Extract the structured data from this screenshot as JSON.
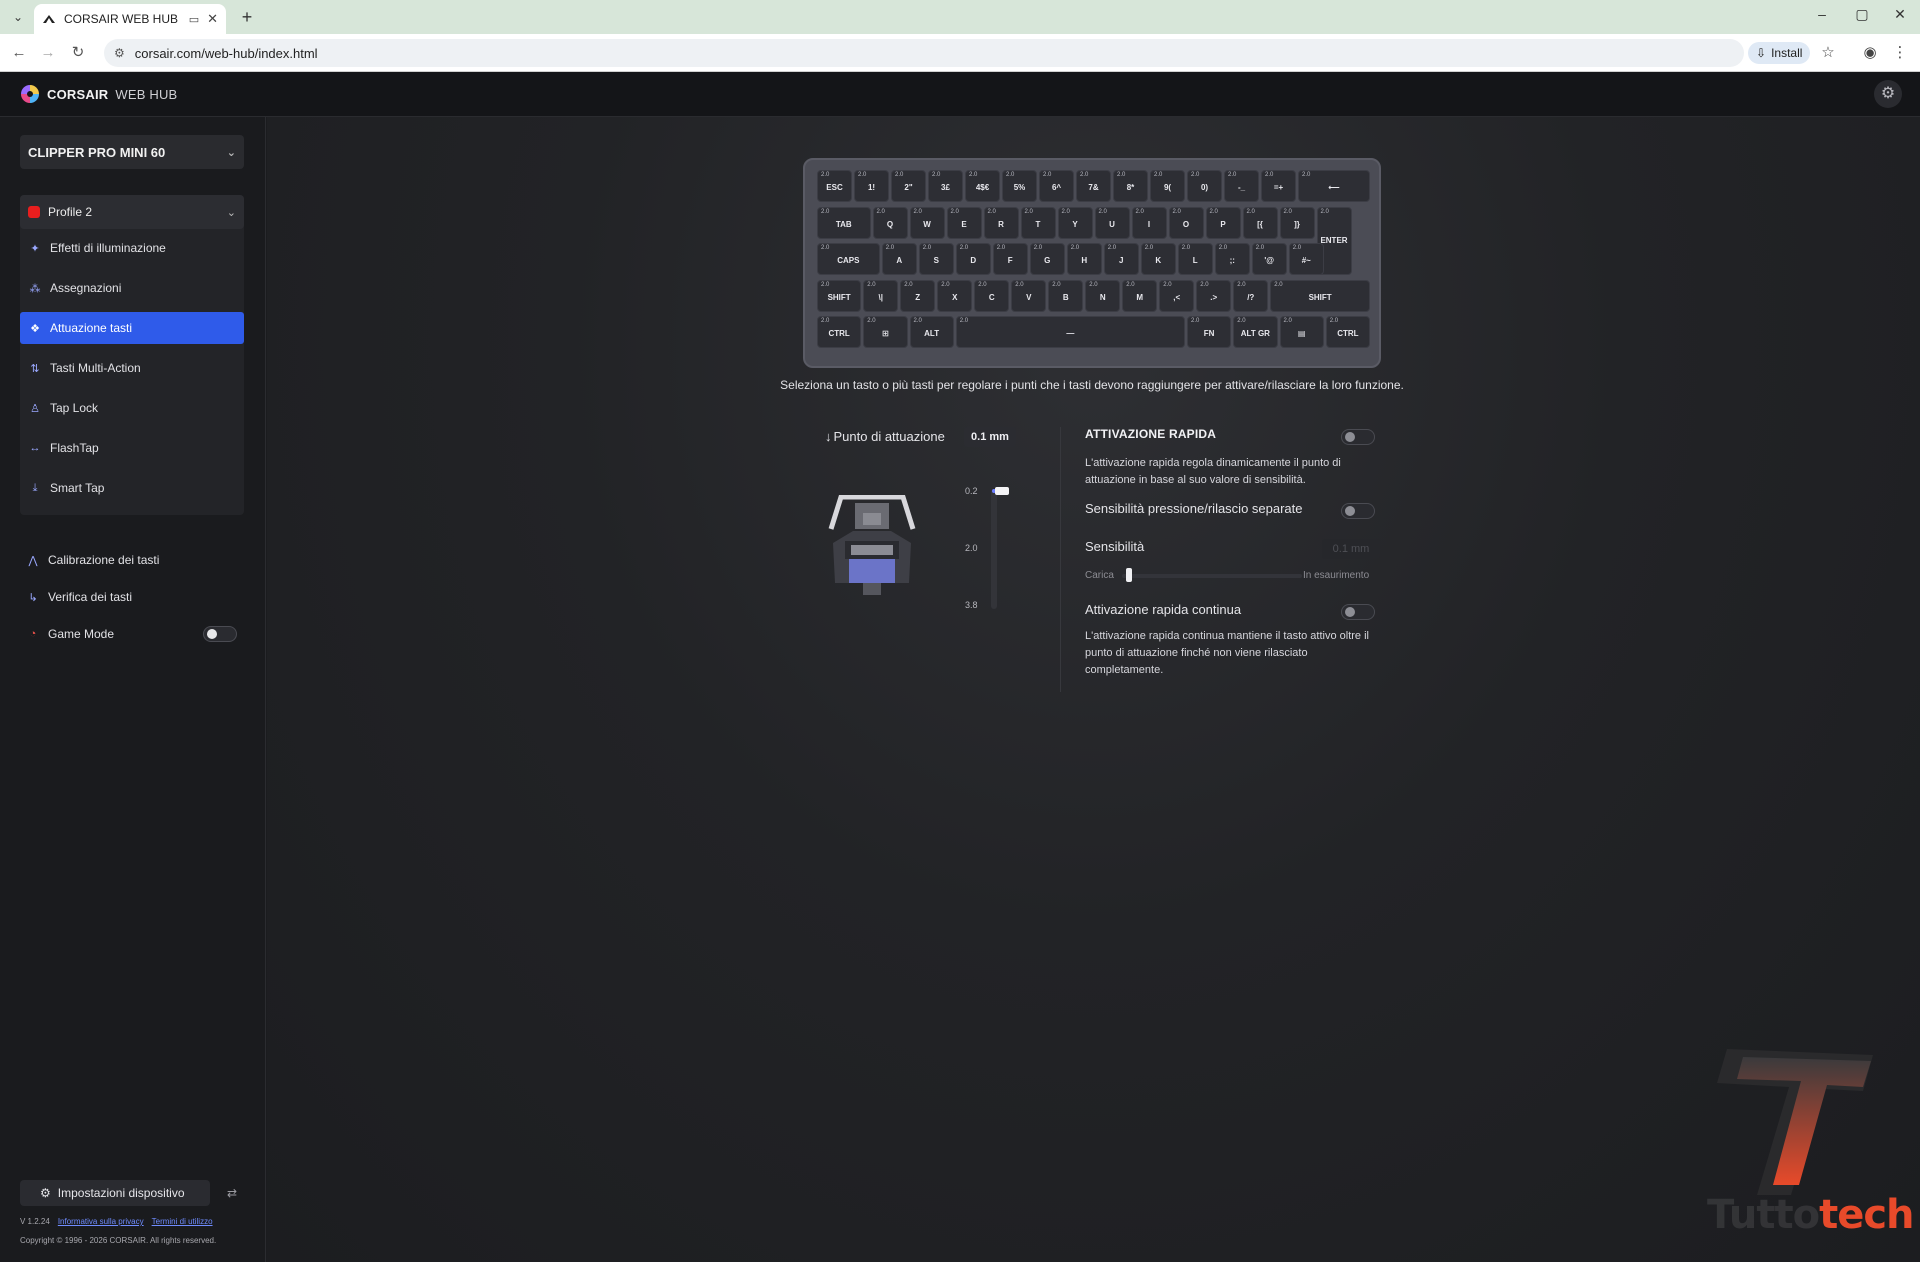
{
  "browser": {
    "tab_title": "CORSAIR WEB HUB",
    "url": "corsair.com/web-hub/index.html",
    "install_label": "Install"
  },
  "app": {
    "brand": "CORSAIR",
    "brand_sub": "WEB HUB"
  },
  "sidebar": {
    "device": "CLIPPER PRO MINI 60",
    "profile": "Profile 2",
    "profile_color": "#e81e1e",
    "menu": [
      {
        "label": "Effetti di illuminazione",
        "icon": "sparkle-icon"
      },
      {
        "label": "Assegnazioni",
        "icon": "assign-icon"
      },
      {
        "label": "Attuazione tasti",
        "icon": "actuation-icon"
      },
      {
        "label": "Tasti Multi-Action",
        "icon": "multi-action-icon"
      },
      {
        "label": "Tap Lock",
        "icon": "tap-lock-icon"
      },
      {
        "label": "FlashTap",
        "icon": "flashtap-icon"
      },
      {
        "label": "Smart Tap",
        "icon": "smart-tap-icon"
      }
    ],
    "active_item": "Attuazione tasti",
    "links": [
      {
        "label": "Calibrazione dei tasti"
      },
      {
        "label": "Verifica dei tasti"
      },
      {
        "label": "Game Mode"
      }
    ],
    "device_settings": "Impostazioni dispositivo",
    "version": "V 1.2.24",
    "privacy": "Informativa sulla privacy",
    "terms": "Termini di utilizzo",
    "copyright": "Copyright © 1996 - 2026 CORSAIR. All rights reserved."
  },
  "keyboard": {
    "key_value": "2.0",
    "rows": [
      [
        "ESC",
        "1!",
        "2\"",
        "3£",
        "4$€",
        "5%",
        "6^",
        "7&",
        "8*",
        "9(",
        "0)",
        "-_",
        "=+",
        "⟵"
      ],
      [
        "TAB",
        "Q",
        "W",
        "E",
        "R",
        "T",
        "Y",
        "U",
        "I",
        "O",
        "P",
        "[{",
        "]}",
        "ENTER"
      ],
      [
        "CAPS",
        "A",
        "S",
        "D",
        "F",
        "G",
        "H",
        "J",
        "K",
        "L",
        ";:",
        "'@",
        "#~"
      ],
      [
        "SHIFT",
        "\\|",
        "Z",
        "X",
        "C",
        "V",
        "B",
        "N",
        "M",
        ",<",
        ".>",
        "/?",
        "SHIFT"
      ],
      [
        "CTRL",
        "⊞",
        "ALT",
        "—",
        "FN",
        "ALT GR",
        "▤",
        "CTRL"
      ]
    ]
  },
  "main": {
    "instruction": "Seleziona un tasto o più tasti per regolare i punti che i tasti devono raggiungere per attivare/rilasciare la loro funzione.",
    "actuation_label": "Punto di attuazione",
    "actuation_value": "0.1 mm",
    "ticks": [
      "0.2",
      "2.0",
      "3.8"
    ],
    "rapid_title": "ATTIVAZIONE RAPIDA",
    "rapid_desc": "L'attivazione rapida regola dinamicamente il punto di attuazione in base al suo valore di sensibilità.",
    "separate_label": "Sensibilità pressione/rilascio separate",
    "sensitivity_label": "Sensibilità",
    "sensitivity_value": "0.1 mm",
    "sens_min": "Carica",
    "sens_max": "In esaurimento",
    "continuous_label": "Attivazione rapida continua",
    "continuous_desc": "L'attivazione rapida continua mantiene il tasto attivo oltre il punto di attuazione finché non viene rilasciato completamente."
  },
  "watermark": {
    "text_a": "Tutto",
    "text_b": "tech"
  },
  "colors": {
    "accent": "#2f5bea",
    "watermark": "#e84a2a"
  }
}
